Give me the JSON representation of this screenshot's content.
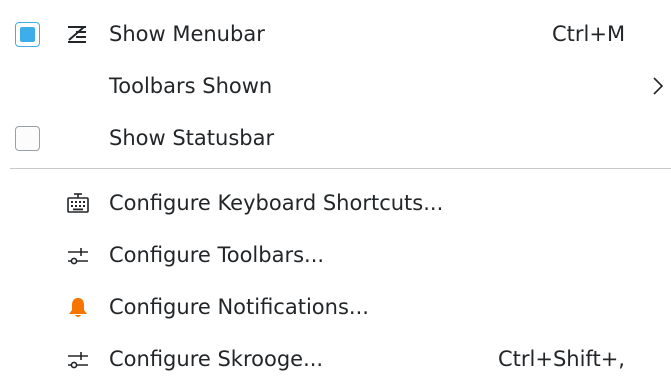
{
  "menu": {
    "items": [
      {
        "label": "Show Menubar",
        "shortcut": "Ctrl+M",
        "checked": true,
        "icon": "show-menubar-icon"
      },
      {
        "label": "Toolbars Shown",
        "submenu": true
      },
      {
        "label": "Show Statusbar",
        "checked": false
      },
      {
        "label": "Configure Keyboard Shortcuts...",
        "icon": "keyboard-icon"
      },
      {
        "label": "Configure Toolbars...",
        "icon": "toolbar-config-icon"
      },
      {
        "label": "Configure Notifications...",
        "icon": "bell-icon"
      },
      {
        "label": "Configure Skrooge...",
        "shortcut": "Ctrl+Shift+,",
        "icon": "settings-sliders-icon"
      }
    ]
  },
  "colors": {
    "accent": "#3daee9",
    "bell": "#f67400",
    "text": "#232629"
  }
}
